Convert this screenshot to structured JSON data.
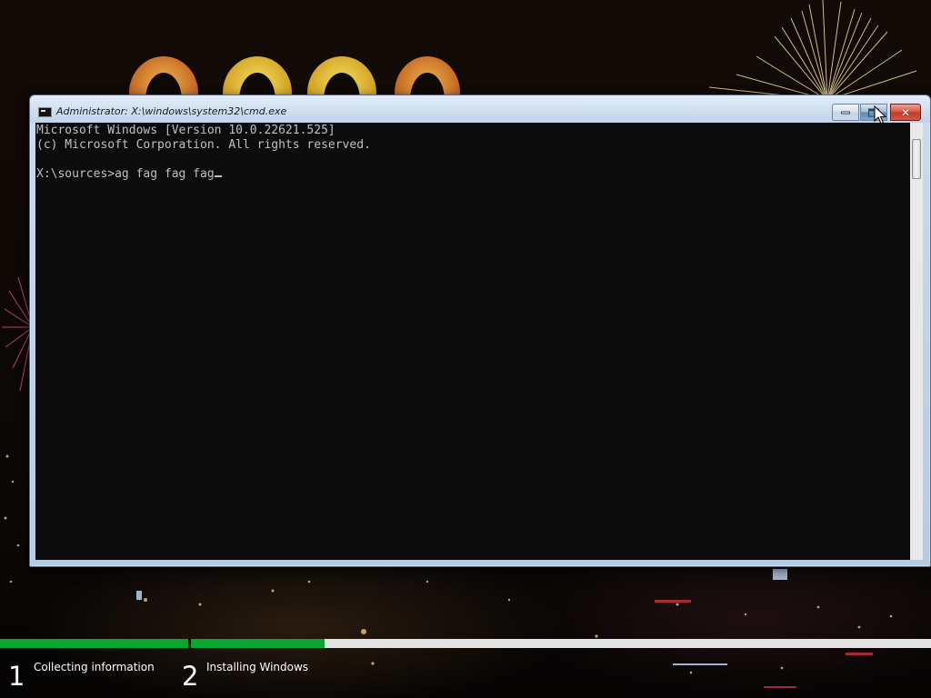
{
  "window": {
    "title": "Administrator: X:\\windows\\system32\\cmd.exe",
    "icon": "cmd-icon",
    "controls": {
      "minimize_icon": "minimize-icon",
      "maximize_icon": "maximize-icon",
      "close_glyph": "✕"
    }
  },
  "console": {
    "lines": [
      "Microsoft Windows [Version 10.0.22621.525]",
      "(c) Microsoft Corporation. All rights reserved.",
      "X:\\sources>ag fag fag fag"
    ],
    "text_color": "#c0c0c0",
    "background": "#0c0c0c"
  },
  "setup_progress": {
    "steps": [
      {
        "number": "1",
        "label": "Collecting information",
        "progress": 1.0
      },
      {
        "number": "2",
        "label": "Installing Windows",
        "progress": 0.18
      }
    ],
    "accent": "#08a52f"
  }
}
